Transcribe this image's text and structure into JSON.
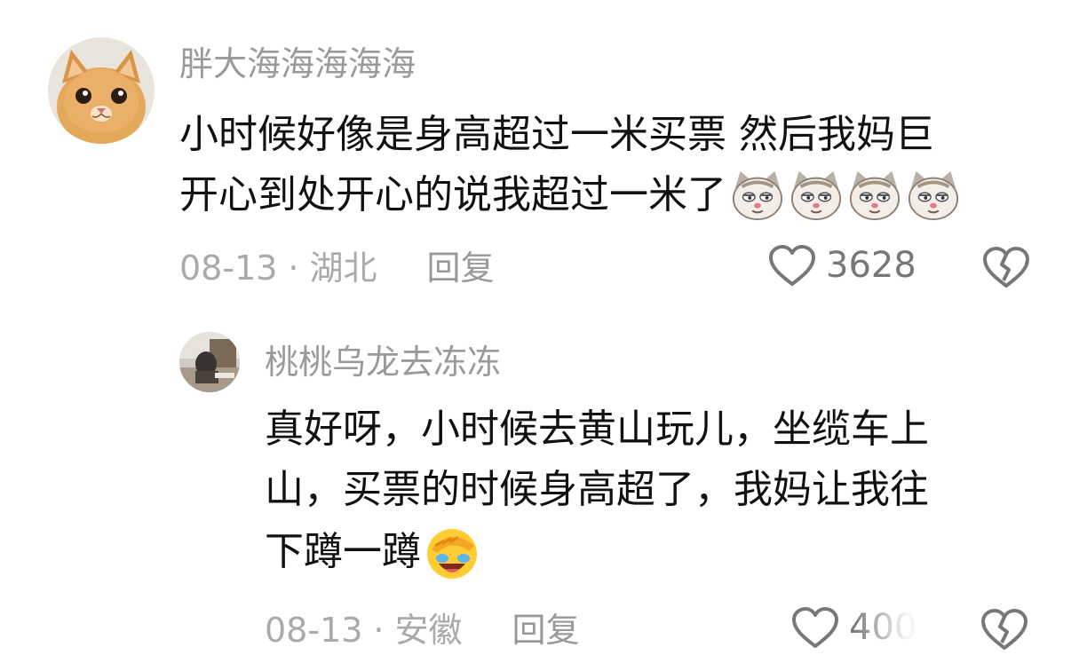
{
  "comments": [
    {
      "username": "胖大海海海海海",
      "avatar_icon": "cat-avatar-icon",
      "lines": [
        "小时候好像是身高超过一米买票 然后我妈巨",
        "开心到处开心的说我超过一米了"
      ],
      "emojis": [
        "smug-cat-emoji",
        "smug-cat-emoji",
        "smug-cat-emoji",
        "smug-cat-emoji"
      ],
      "date": "08-13",
      "separator": "·",
      "location": "湖北",
      "reply_label": "回复",
      "like_count": "3628"
    },
    {
      "username": "桃桃乌龙去冻冻",
      "avatar_icon": "photo-avatar-icon",
      "lines": [
        "真好呀，小时候去黄山玩儿，坐缆车上",
        "山，买票的时候身高超了，我妈让我往",
        "下蹲一蹲"
      ],
      "emojis": [
        "laughing-facepalm-emoji"
      ],
      "date": "08-13",
      "separator": "·",
      "location": "安徽",
      "reply_label": "回复",
      "like_count": "400"
    }
  ],
  "colors": {
    "username": "#9a9a9a",
    "text": "#111111",
    "meta": "#aaaaaa",
    "icon": "#777777"
  }
}
